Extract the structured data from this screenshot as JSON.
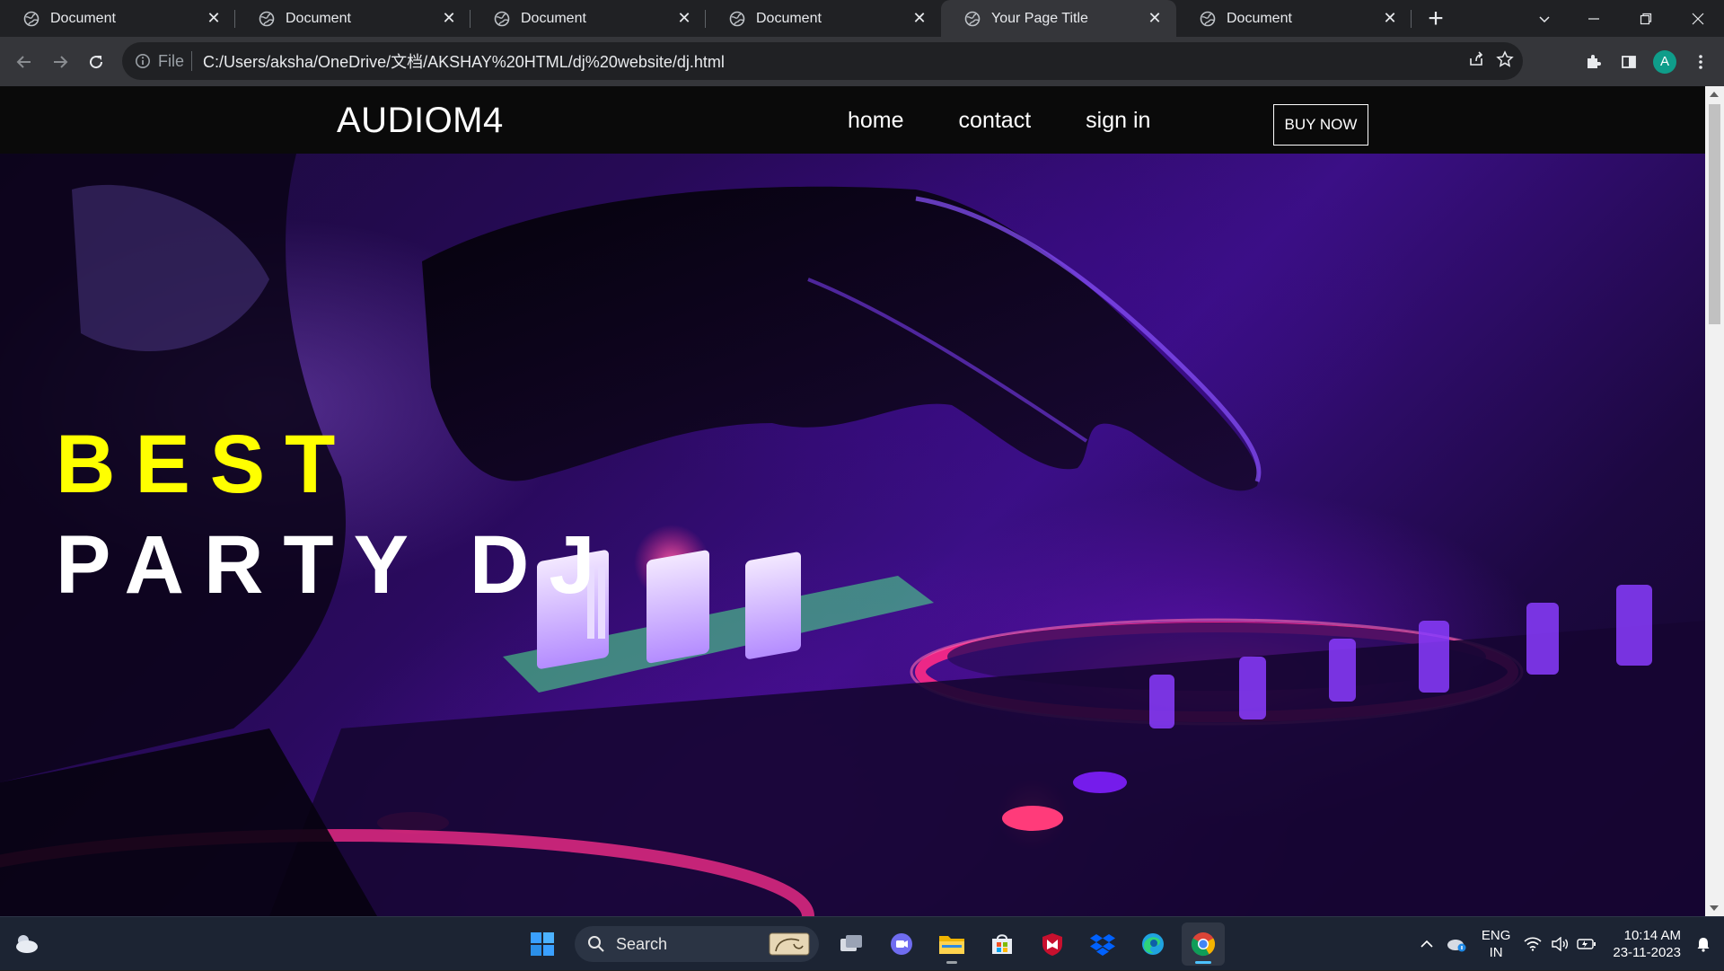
{
  "browser": {
    "tabs": [
      {
        "title": "Document",
        "active": false
      },
      {
        "title": "Document",
        "active": false
      },
      {
        "title": "Document",
        "active": false
      },
      {
        "title": "Document",
        "active": false
      },
      {
        "title": "Your Page Title",
        "active": true
      },
      {
        "title": "Document",
        "active": false
      }
    ],
    "address": {
      "scheme_label": "File",
      "url": "C:/Users/aksha/OneDrive/文档/AKSHAY%20HTML/dj%20website/dj.html"
    },
    "profile_initial": "A"
  },
  "page": {
    "brand": "AUDIOM4",
    "nav": [
      "home",
      "contact",
      "sign in"
    ],
    "cta": "BUY NOW",
    "headline_line1": "BEST",
    "headline_line2": "PARTY DJ",
    "colors": {
      "headline_accent": "#ffff00",
      "headline_main": "#ffffff",
      "nav_bg": "#0a0a0a"
    }
  },
  "taskbar": {
    "search_label": "Search",
    "lang_line1": "ENG",
    "lang_line2": "IN",
    "time": "10:14 AM",
    "date": "23-11-2023"
  }
}
